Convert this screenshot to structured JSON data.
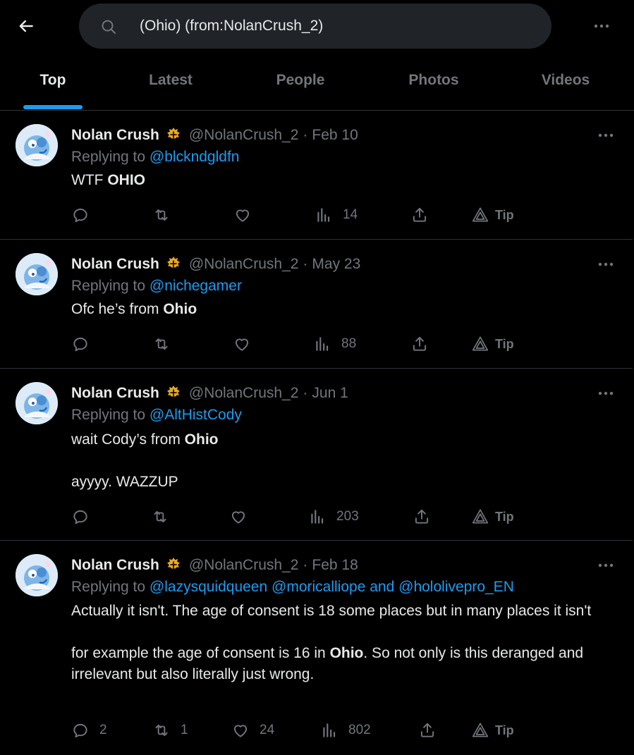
{
  "search": {
    "query": "(Ohio) (from:NolanCrush_2)"
  },
  "tabs": [
    "Top",
    "Latest",
    "People",
    "Photos",
    "Videos"
  ],
  "accent_color": "#1d9bf0",
  "tweets": [
    {
      "name": "Nolan Crush",
      "handle": "@NolanCrush_2",
      "dot": "·",
      "date": "Feb 10",
      "replying_prefix": "Replying to ",
      "mentions": "@blckndgldfn",
      "body_plain_1": "WTF ",
      "body_bold_1": "OHIO",
      "stats": {
        "replies": "",
        "retweets": "",
        "likes": "",
        "views": "14"
      },
      "tip_label": "Tip"
    },
    {
      "name": "Nolan Crush",
      "handle": "@NolanCrush_2",
      "dot": "·",
      "date": "May 23",
      "replying_prefix": "Replying to ",
      "mentions": "@nichegamer",
      "body_plain_1": "Ofc he’s from ",
      "body_bold_1": "Ohio",
      "stats": {
        "replies": "",
        "retweets": "",
        "likes": "",
        "views": "88"
      },
      "tip_label": "Tip"
    },
    {
      "name": "Nolan Crush",
      "handle": "@NolanCrush_2",
      "dot": "·",
      "date": "Jun 1",
      "replying_prefix": "Replying to ",
      "mentions": "@AltHistCody",
      "body_plain_1": "wait Cody’s from ",
      "body_bold_1": "Ohio",
      "body_line_2": "ayyyy. WAZZUP",
      "stats": {
        "replies": "",
        "retweets": "",
        "likes": "",
        "views": "203"
      },
      "tip_label": "Tip"
    },
    {
      "name": "Nolan Crush",
      "handle": "@NolanCrush_2",
      "dot": "·",
      "date": "Feb 18",
      "replying_prefix": "Replying to ",
      "mention_1": "@lazysquidqueen",
      "mention_2": "@moricalliope",
      "mention_and": "and",
      "mention_3": "@hololivepro_EN",
      "body_para_1": "Actually it isn't. The age of consent is 18  some places but in many places it isn't",
      "body_para_2_plain_a": "for example the age of consent is 16 in ",
      "body_para_2_bold": "Ohio",
      "body_para_2_plain_b": ". So not only is this deranged and irrelevant but also literally just wrong.",
      "stats": {
        "replies": "2",
        "retweets": "1",
        "likes": "24",
        "views": "802"
      },
      "tip_label": "Tip"
    }
  ]
}
